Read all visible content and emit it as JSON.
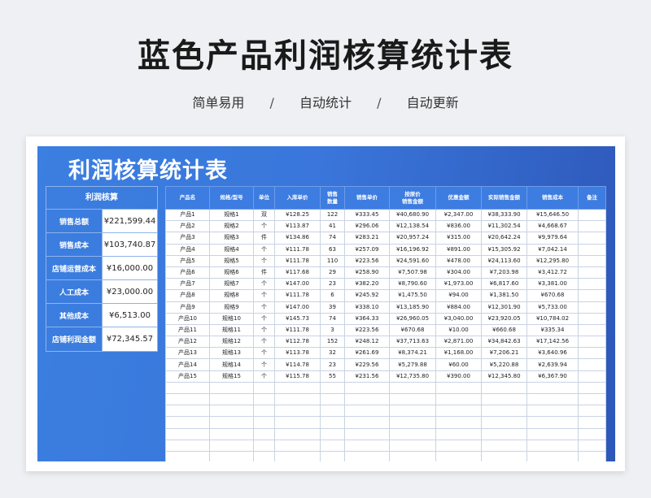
{
  "header": {
    "title": "蓝色产品利润核算统计表",
    "tags": [
      "简单易用",
      "自动统计",
      "自动更新"
    ],
    "separator": "/"
  },
  "sheet": {
    "title": "利润核算统计表"
  },
  "summary": {
    "title": "利润核算",
    "rows": [
      {
        "label": "销售总额",
        "value": "¥221,599.44"
      },
      {
        "label": "销售成本",
        "value": "¥103,740.87"
      },
      {
        "label": "店铺运营成本",
        "value": "¥16,000.00"
      },
      {
        "label": "人工成本",
        "value": "¥23,000.00"
      },
      {
        "label": "其他成本",
        "value": "¥6,513.00"
      },
      {
        "label": "店铺利润金额",
        "value": "¥72,345.57"
      }
    ]
  },
  "table": {
    "columns": [
      "产品名",
      "规格/型号",
      "单位",
      "入库单价",
      "销售\n数量",
      "销售单价",
      "按原价\n销售金额",
      "优惠金额",
      "实际销售金额",
      "销售成本",
      "备注"
    ],
    "rows": [
      [
        "产品1",
        "规格1",
        "双",
        "¥128.25",
        "122",
        "¥333.45",
        "¥40,680.90",
        "¥2,347.00",
        "¥38,333.90",
        "¥15,646.50",
        ""
      ],
      [
        "产品2",
        "规格2",
        "个",
        "¥113.87",
        "41",
        "¥296.06",
        "¥12,138.54",
        "¥836.00",
        "¥11,302.54",
        "¥4,668.67",
        ""
      ],
      [
        "产品3",
        "规格3",
        "件",
        "¥134.86",
        "74",
        "¥283.21",
        "¥20,957.24",
        "¥315.00",
        "¥20,642.24",
        "¥9,979.64",
        ""
      ],
      [
        "产品4",
        "规格4",
        "个",
        "¥111.78",
        "63",
        "¥257.09",
        "¥16,196.92",
        "¥891.00",
        "¥15,305.92",
        "¥7,042.14",
        ""
      ],
      [
        "产品5",
        "规格5",
        "个",
        "¥111.78",
        "110",
        "¥223.56",
        "¥24,591.60",
        "¥478.00",
        "¥24,113.60",
        "¥12,295.80",
        ""
      ],
      [
        "产品6",
        "规格6",
        "件",
        "¥117.68",
        "29",
        "¥258.90",
        "¥7,507.98",
        "¥304.00",
        "¥7,203.98",
        "¥3,412.72",
        ""
      ],
      [
        "产品7",
        "规格7",
        "个",
        "¥147.00",
        "23",
        "¥382.20",
        "¥8,790.60",
        "¥1,973.00",
        "¥6,817.60",
        "¥3,381.00",
        ""
      ],
      [
        "产品8",
        "规格8",
        "个",
        "¥111.78",
        "6",
        "¥245.92",
        "¥1,475.50",
        "¥94.00",
        "¥1,381.50",
        "¥670.68",
        ""
      ],
      [
        "产品9",
        "规格9",
        "个",
        "¥147.00",
        "39",
        "¥338.10",
        "¥13,185.90",
        "¥884.00",
        "¥12,301.90",
        "¥5,733.00",
        ""
      ],
      [
        "产品10",
        "规格10",
        "个",
        "¥145.73",
        "74",
        "¥364.33",
        "¥26,960.05",
        "¥3,040.00",
        "¥23,920.05",
        "¥10,784.02",
        ""
      ],
      [
        "产品11",
        "规格11",
        "个",
        "¥111.78",
        "3",
        "¥223.56",
        "¥670.68",
        "¥10.00",
        "¥660.68",
        "¥335.34",
        ""
      ],
      [
        "产品12",
        "规格12",
        "个",
        "¥112.78",
        "152",
        "¥248.12",
        "¥37,713.63",
        "¥2,871.00",
        "¥34,842.63",
        "¥17,142.56",
        ""
      ],
      [
        "产品13",
        "规格13",
        "个",
        "¥113.78",
        "32",
        "¥261.69",
        "¥8,374.21",
        "¥1,168.00",
        "¥7,206.21",
        "¥3,640.96",
        ""
      ],
      [
        "产品14",
        "规格14",
        "个",
        "¥114.78",
        "23",
        "¥229.56",
        "¥5,279.88",
        "¥60.00",
        "¥5,220.88",
        "¥2,639.94",
        ""
      ],
      [
        "产品15",
        "规格15",
        "个",
        "¥115.78",
        "55",
        "¥231.56",
        "¥12,735.80",
        "¥390.00",
        "¥12,345.80",
        "¥6,367.90",
        ""
      ]
    ],
    "empty_rows": 7
  }
}
